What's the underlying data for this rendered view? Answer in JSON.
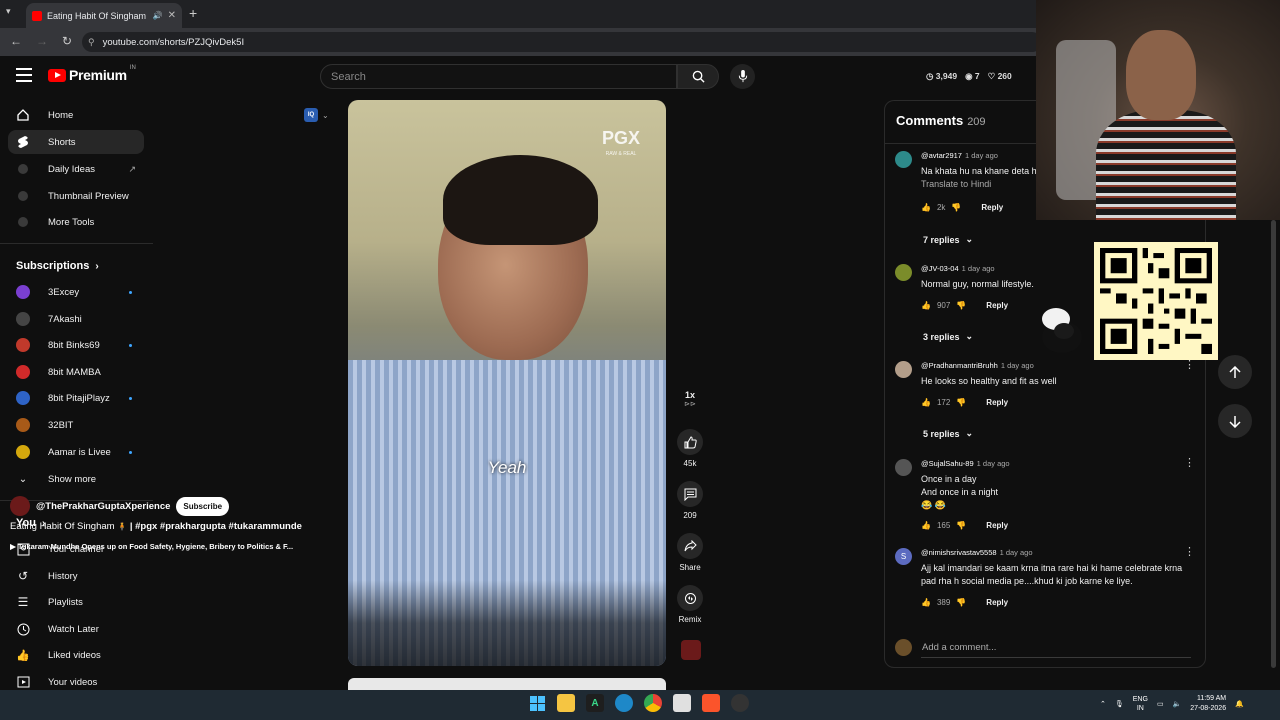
{
  "browser": {
    "tab_title": "Eating Habit Of Singham",
    "url": "youtube.com/shorts/PZJQivDek5I"
  },
  "header": {
    "logo_text": "Premium",
    "logo_country": "IN",
    "search_placeholder": "Search",
    "stats": {
      "clock_value": "3,949",
      "views_value": "7",
      "likes_value": "260"
    }
  },
  "sidebar": {
    "main": [
      {
        "label": "Home"
      },
      {
        "label": "Shorts"
      },
      {
        "label": "Daily Ideas"
      },
      {
        "label": "Thumbnail Preview"
      },
      {
        "label": "More Tools"
      }
    ],
    "subscriptions_header": "Subscriptions",
    "subscriptions": [
      {
        "label": "3Excey",
        "color": "#7a3fd0",
        "dot": true
      },
      {
        "label": "7Akashi",
        "color": "#444444",
        "dot": false
      },
      {
        "label": "8bit Binks69",
        "color": "#c0392b",
        "dot": true
      },
      {
        "label": "8bit MAMBA",
        "color": "#d02a2a",
        "dot": false
      },
      {
        "label": "8bit PitajiPlayz",
        "color": "#2e63c6",
        "dot": true
      },
      {
        "label": "32BIT",
        "color": "#a85a18",
        "dot": false
      },
      {
        "label": "Aamar is Livee",
        "color": "#d4a80d",
        "dot": true
      }
    ],
    "show_more": "Show more",
    "you_header": "You",
    "you_items": [
      {
        "label": "Your channel"
      },
      {
        "label": "History"
      },
      {
        "label": "Playlists"
      },
      {
        "label": "Watch Later"
      },
      {
        "label": "Liked videos"
      },
      {
        "label": "Your videos"
      }
    ]
  },
  "video": {
    "caption": "Yeah",
    "watermark": "PGX",
    "watermark_sub": "RAW & REAL",
    "channel": "@ThePrakharGuptaXperience",
    "subscribe": "Subscribe",
    "title": "Eating Habit Of Singham",
    "hashtags": "| #pgx #prakhargupta #tukarammunde",
    "related": "Tukaram Mundhe Opens up on Food Safety, Hygiene, Bribery to Politics & F..."
  },
  "actions": {
    "speed": "1x",
    "likes": "45k",
    "comments": "209",
    "share": "Share",
    "remix": "Remix"
  },
  "comments": {
    "title": "Comments",
    "count": "209",
    "items": [
      {
        "author": "@avtar2917",
        "time": "1 day ago",
        "text": "Na khata hu na khane deta h",
        "translate": "Translate to Hindi",
        "likes": "2k",
        "reply": "Reply",
        "replies": "7 replies",
        "avatar_color": "#2d8a8a"
      },
      {
        "author": "@JV-03-04",
        "time": "1 day ago",
        "text": "Normal guy, normal lifestyle.",
        "likes": "907",
        "reply": "Reply",
        "replies": "3 replies",
        "avatar_color": "#7b8c2a"
      },
      {
        "author": "@PradhanmantriBruhh",
        "time": "1 day ago",
        "text": "He looks so healthy and fit as well",
        "likes": "172",
        "reply": "Reply",
        "replies": "5 replies",
        "avatar_color": "#b39e8a"
      },
      {
        "author": "@SujalSahu-89",
        "time": "1 day ago",
        "text_lines": [
          "Once in a day",
          "And once in a night",
          "😂 😂"
        ],
        "likes": "165",
        "reply": "Reply",
        "avatar_color": "#555555"
      },
      {
        "author": "@nimishsrivastav5558",
        "time": "1 day ago",
        "avatar_letter": "S",
        "text": "Ajj kal imandari se kaam krna itna rare hai ki hame celebrate krna pad rha h social media pe....khud ki job karne ke liye.",
        "likes": "389",
        "reply": "Reply",
        "avatar_color": "#5c6bc0"
      }
    ],
    "add_placeholder": "Add a comment..."
  },
  "taskbar": {
    "lang_top": "ENG",
    "lang_bottom": "IN",
    "time": "11:59 AM",
    "date": "27-08-2026"
  }
}
